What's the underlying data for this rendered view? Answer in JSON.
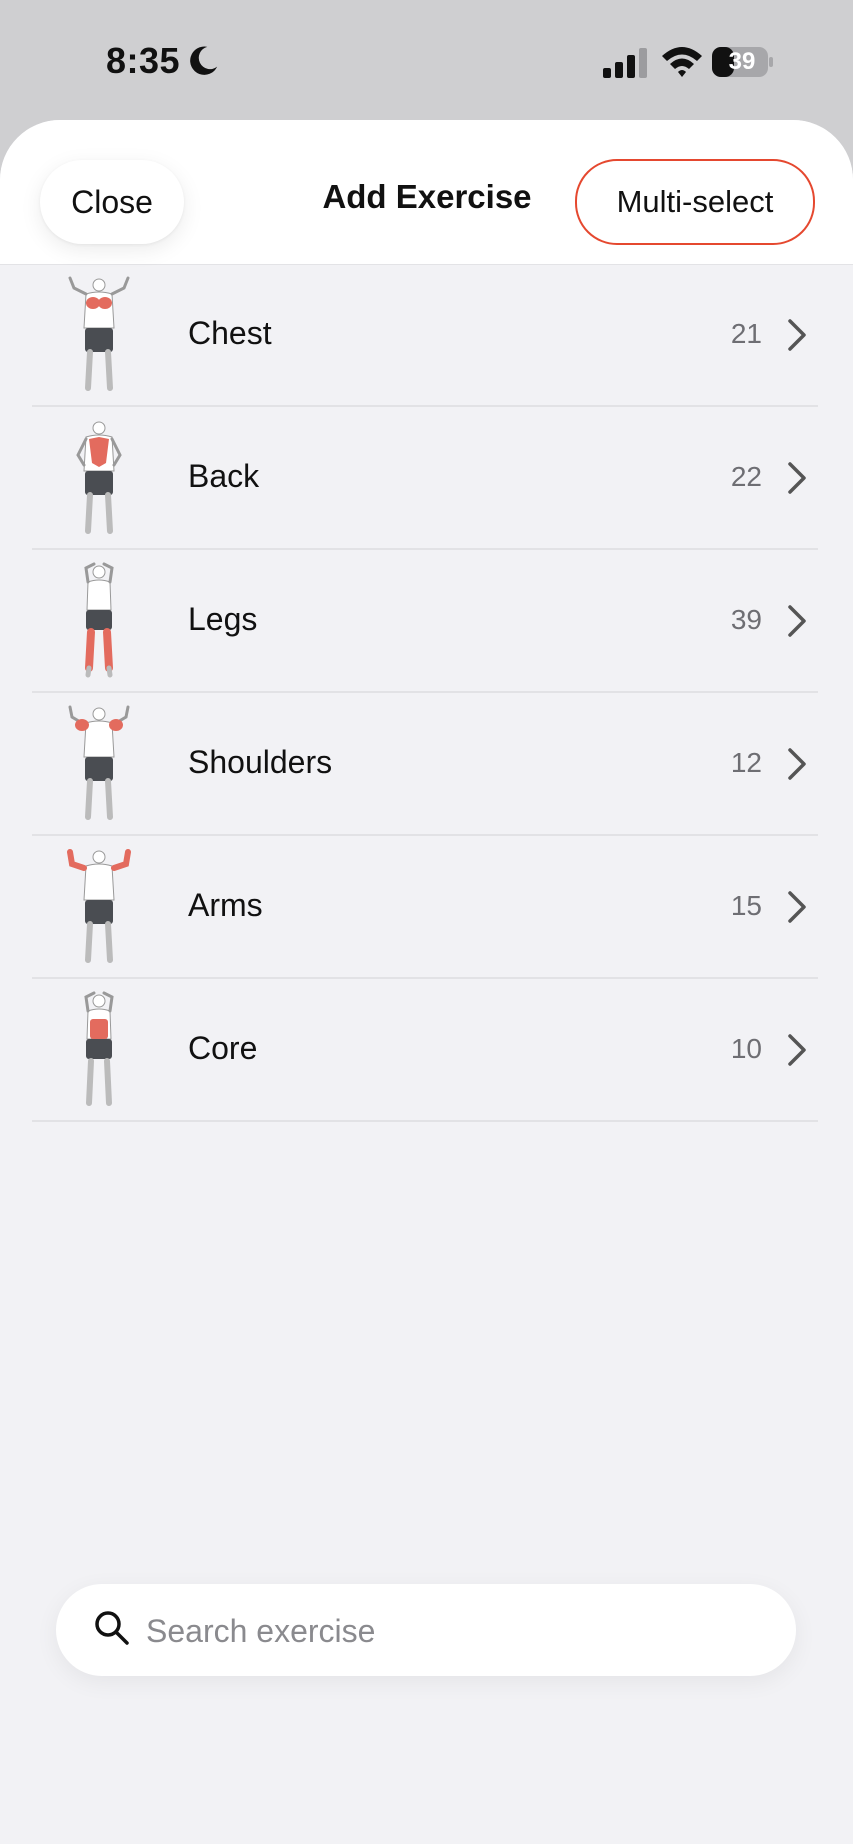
{
  "status_bar": {
    "time": "8:35",
    "battery": "39"
  },
  "header": {
    "close_label": "Close",
    "title": "Add Exercise",
    "multi_select_label": "Multi-select"
  },
  "categories": [
    {
      "label": "Chest",
      "count": "21",
      "highlight": "chest"
    },
    {
      "label": "Back",
      "count": "22",
      "highlight": "back"
    },
    {
      "label": "Legs",
      "count": "39",
      "highlight": "legs"
    },
    {
      "label": "Shoulders",
      "count": "12",
      "highlight": "shoulders"
    },
    {
      "label": "Arms",
      "count": "15",
      "highlight": "arms"
    },
    {
      "label": "Core",
      "count": "10",
      "highlight": "core"
    }
  ],
  "search": {
    "placeholder": "Search exercise"
  },
  "colors": {
    "accent": "#e5482f",
    "muscle": "#e36b5e"
  }
}
